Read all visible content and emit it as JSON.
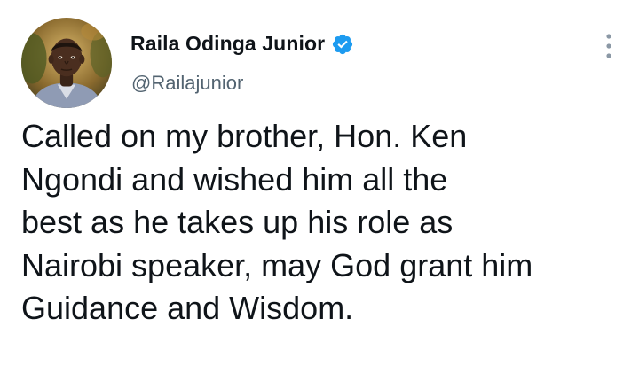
{
  "author": {
    "display_name": "Raila Odinga Junior",
    "handle": "@Railajunior",
    "verified": true,
    "verified_color": "#1d9bf0",
    "avatar_icon": "profile-photo"
  },
  "menu": {
    "icon": "more-vertical-icon"
  },
  "tweet": {
    "lines": [
      "Called on my brother, Hon. Ken",
      "Ngondi and wished him all the",
      "best as he takes up his role as",
      "Nairobi speaker, may God grant him",
      "Guidance and Wisdom."
    ]
  }
}
